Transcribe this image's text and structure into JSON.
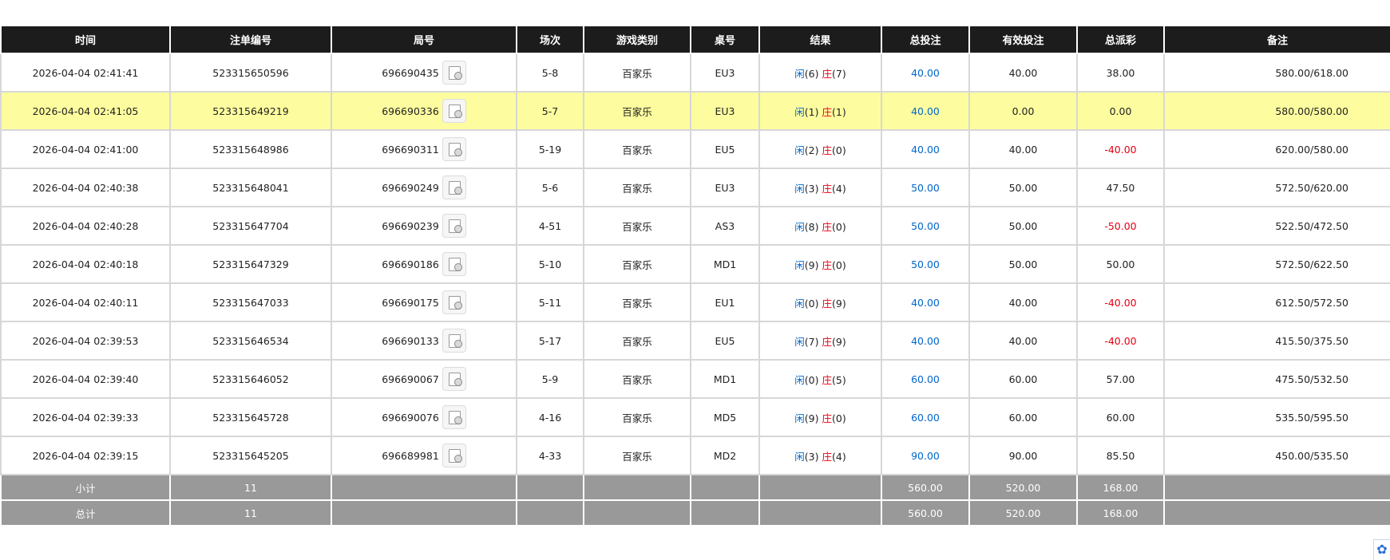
{
  "headers": [
    "时间",
    "注单编号",
    "局号",
    "场次",
    "游戏类别",
    "桌号",
    "结果",
    "总投注",
    "有效投注",
    "总派彩",
    "备注"
  ],
  "result_labels": {
    "player": "闲",
    "banker": "庄"
  },
  "rows": [
    {
      "time": "2026-04-04 02:41:41",
      "bet_no": "523315650596",
      "round_no": "696690435",
      "shoe": "5-8",
      "game": "百家乐",
      "table": "EU3",
      "player": "(6)",
      "banker": "(7)",
      "total_bet": "40.00",
      "valid_bet": "40.00",
      "payout": "38.00",
      "payout_negative": false,
      "note": "580.00/618.00",
      "highlight": false
    },
    {
      "time": "2026-04-04 02:41:05",
      "bet_no": "523315649219",
      "round_no": "696690336",
      "shoe": "5-7",
      "game": "百家乐",
      "table": "EU3",
      "player": "(1)",
      "banker": "(1)",
      "total_bet": "40.00",
      "valid_bet": "0.00",
      "payout": "0.00",
      "payout_negative": false,
      "note": "580.00/580.00",
      "highlight": true
    },
    {
      "time": "2026-04-04 02:41:00",
      "bet_no": "523315648986",
      "round_no": "696690311",
      "shoe": "5-19",
      "game": "百家乐",
      "table": "EU5",
      "player": "(2)",
      "banker": "(0)",
      "total_bet": "40.00",
      "valid_bet": "40.00",
      "payout": "-40.00",
      "payout_negative": true,
      "note": "620.00/580.00",
      "highlight": false
    },
    {
      "time": "2026-04-04 02:40:38",
      "bet_no": "523315648041",
      "round_no": "696690249",
      "shoe": "5-6",
      "game": "百家乐",
      "table": "EU3",
      "player": "(3)",
      "banker": "(4)",
      "total_bet": "50.00",
      "valid_bet": "50.00",
      "payout": "47.50",
      "payout_negative": false,
      "note": "572.50/620.00",
      "highlight": false
    },
    {
      "time": "2026-04-04 02:40:28",
      "bet_no": "523315647704",
      "round_no": "696690239",
      "shoe": "4-51",
      "game": "百家乐",
      "table": "AS3",
      "player": "(8)",
      "banker": "(0)",
      "total_bet": "50.00",
      "valid_bet": "50.00",
      "payout": "-50.00",
      "payout_negative": true,
      "note": "522.50/472.50",
      "highlight": false
    },
    {
      "time": "2026-04-04 02:40:18",
      "bet_no": "523315647329",
      "round_no": "696690186",
      "shoe": "5-10",
      "game": "百家乐",
      "table": "MD1",
      "player": "(9)",
      "banker": "(0)",
      "total_bet": "50.00",
      "valid_bet": "50.00",
      "payout": "50.00",
      "payout_negative": false,
      "note": "572.50/622.50",
      "highlight": false
    },
    {
      "time": "2026-04-04 02:40:11",
      "bet_no": "523315647033",
      "round_no": "696690175",
      "shoe": "5-11",
      "game": "百家乐",
      "table": "EU1",
      "player": "(0)",
      "banker": "(9)",
      "total_bet": "40.00",
      "valid_bet": "40.00",
      "payout": "-40.00",
      "payout_negative": true,
      "note": "612.50/572.50",
      "highlight": false
    },
    {
      "time": "2026-04-04 02:39:53",
      "bet_no": "523315646534",
      "round_no": "696690133",
      "shoe": "5-17",
      "game": "百家乐",
      "table": "EU5",
      "player": "(7)",
      "banker": "(9)",
      "total_bet": "40.00",
      "valid_bet": "40.00",
      "payout": "-40.00",
      "payout_negative": true,
      "note": "415.50/375.50",
      "highlight": false
    },
    {
      "time": "2026-04-04 02:39:40",
      "bet_no": "523315646052",
      "round_no": "696690067",
      "shoe": "5-9",
      "game": "百家乐",
      "table": "MD1",
      "player": "(0)",
      "banker": "(5)",
      "total_bet": "60.00",
      "valid_bet": "60.00",
      "payout": "57.00",
      "payout_negative": false,
      "note": "475.50/532.50",
      "highlight": false
    },
    {
      "time": "2026-04-04 02:39:33",
      "bet_no": "523315645728",
      "round_no": "696690076",
      "shoe": "4-16",
      "game": "百家乐",
      "table": "MD5",
      "player": "(9)",
      "banker": "(0)",
      "total_bet": "60.00",
      "valid_bet": "60.00",
      "payout": "60.00",
      "payout_negative": false,
      "note": "535.50/595.50",
      "highlight": false
    },
    {
      "time": "2026-04-04 02:39:15",
      "bet_no": "523315645205",
      "round_no": "696689981",
      "shoe": "4-33",
      "game": "百家乐",
      "table": "MD2",
      "player": "(3)",
      "banker": "(4)",
      "total_bet": "90.00",
      "valid_bet": "90.00",
      "payout": "85.50",
      "payout_negative": false,
      "note": "450.00/535.50",
      "highlight": false
    }
  ],
  "subtotal": {
    "label": "小计",
    "count": "11",
    "total_bet": "560.00",
    "valid_bet": "520.00",
    "payout": "168.00"
  },
  "total": {
    "label": "总计",
    "count": "11",
    "total_bet": "560.00",
    "valid_bet": "520.00",
    "payout": "168.00"
  },
  "icons": {
    "replay": "replay-icon",
    "corner": "paw-icon"
  },
  "colors": {
    "header_bg": "#1c1c1c",
    "highlight_row": "#fdfd9f",
    "footer_bg": "#999999",
    "bet_blue": "#0066cc",
    "loss_red": "#e60012"
  }
}
